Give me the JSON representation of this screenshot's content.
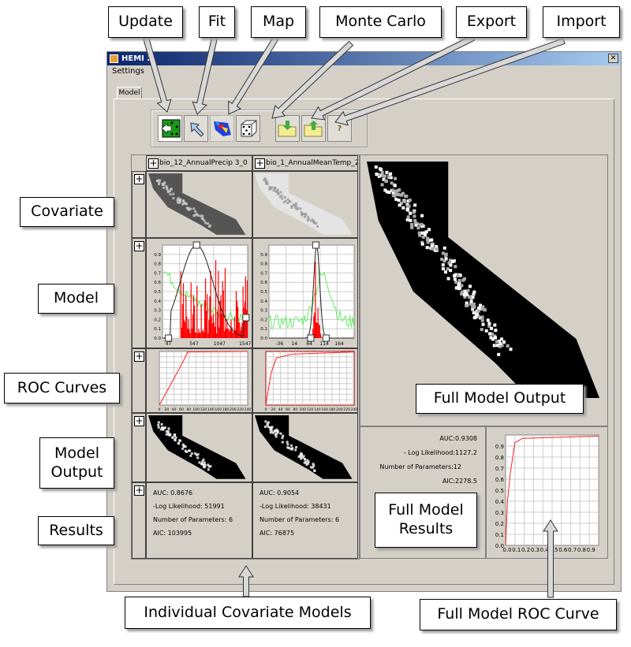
{
  "window": {
    "title": "HEMI 2",
    "close_glyph": "✕",
    "menu": [
      "Settings"
    ],
    "tab": "Model"
  },
  "toolbar": {
    "buttons": [
      {
        "name": "update",
        "icon": "update-icon"
      },
      {
        "name": "fit",
        "icon": "fit-arrow-icon"
      },
      {
        "name": "map",
        "icon": "map-icon"
      },
      {
        "name": "monte-carlo",
        "icon": "dice-icon"
      },
      {
        "name": "export",
        "icon": "folder-export-icon"
      },
      {
        "name": "import",
        "icon": "folder-import-icon"
      },
      {
        "name": "help",
        "icon": "help-icon",
        "label": "?"
      }
    ]
  },
  "columns": [
    {
      "header": "bio_12_AnnualPrecip 3_0",
      "model_xticks": [
        "47",
        "547",
        "1047",
        "1547"
      ],
      "results": {
        "auc": "AUC: 0.8676",
        "loglik": "-Log Likelihood: 51991",
        "params": "Number of Parameters: 6",
        "aic": "AIC: 103995"
      }
    },
    {
      "header": "bio_1_AnnualMeanTemp_2",
      "model_xticks": [
        "-36",
        "14",
        "64",
        "114",
        "164"
      ],
      "results": {
        "auc": "AUC: 0.9054",
        "loglik": "-Log Likelihood: 38431",
        "params": "Number of Parameters: 6",
        "aic": "AIC: 76875"
      }
    }
  ],
  "model_yticks": [
    "0.0",
    "0.1",
    "0.2",
    "0.3",
    "0.4",
    "0.5",
    "0.6",
    "0.7",
    "0.8",
    "0.9"
  ],
  "roc_xticks": [
    "0",
    "20",
    "40",
    "60",
    "80",
    "100",
    "120",
    "140",
    "160",
    "180",
    "200",
    "220",
    "240"
  ],
  "full_model": {
    "auc": "AUC:0.9308",
    "loglik": "- Log Likelihood:1127.2",
    "params": "Number of Parameters:12",
    "aic": "AIC:2278.5",
    "roc_xticks": [
      "0.0",
      "0.1",
      "0.2",
      "0.3",
      "0.4",
      "0.5",
      "0.6",
      "0.7",
      "0.8",
      "0.9"
    ],
    "roc_yticks": [
      "0.0",
      "0.1",
      "0.2",
      "0.3",
      "0.4",
      "0.5",
      "0.6",
      "0.7",
      "0.8",
      "0.9"
    ]
  },
  "colors": {
    "titlebar": "#0a246a",
    "histogram": "#ff0000",
    "background_curve": "#66ee66",
    "roc": "#ff2020"
  },
  "annotations": {
    "update": "Update",
    "fit": "Fit",
    "map": "Map",
    "monte_carlo": "Monte Carlo",
    "export": "Export",
    "import": "Import",
    "covariate": "Covariate",
    "model": "Model",
    "roc": "ROC Curves",
    "model_output": "Model Output",
    "results": "Results",
    "full_output": "Full Model Output",
    "full_results": "Full Model Results",
    "individual": "Individual Covariate Models",
    "full_roc": "Full Model ROC Curve"
  }
}
